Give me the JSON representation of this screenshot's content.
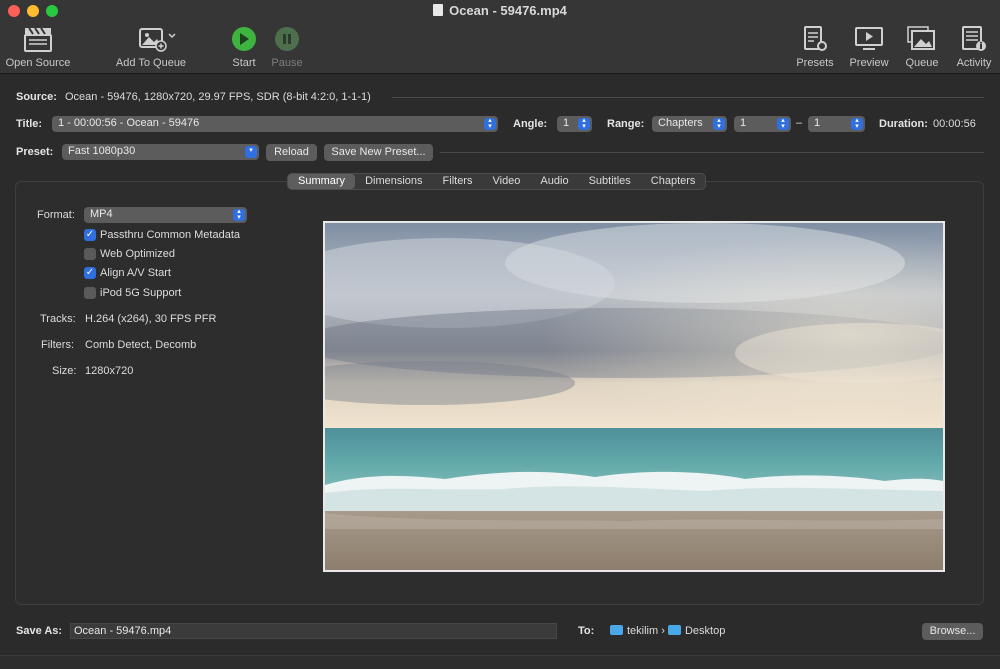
{
  "window": {
    "title": "Ocean - 59476.mp4"
  },
  "toolbar": {
    "open_source": "Open Source",
    "add_to_queue": "Add To Queue",
    "start": "Start",
    "pause": "Pause",
    "presets": "Presets",
    "preview": "Preview",
    "queue": "Queue",
    "activity": "Activity"
  },
  "source": {
    "label": "Source:",
    "value": "Ocean - 59476, 1280x720, 29.97 FPS, SDR (8-bit 4:2:0, 1-1-1)"
  },
  "title_row": {
    "label": "Title:",
    "title_value": "1 - 00:00:56 - Ocean - 59476",
    "angle_label": "Angle:",
    "angle_value": "1",
    "range_label": "Range:",
    "range_type": "Chapters",
    "range_start": "1",
    "range_dash": "–",
    "range_end": "1",
    "duration_label": "Duration:",
    "duration_value": "00:00:56"
  },
  "preset": {
    "label": "Preset:",
    "value": "Fast 1080p30",
    "reload": "Reload",
    "save_new": "Save New Preset..."
  },
  "tabs": [
    "Summary",
    "Dimensions",
    "Filters",
    "Video",
    "Audio",
    "Subtitles",
    "Chapters"
  ],
  "summary": {
    "format_label": "Format:",
    "format_value": "MP4",
    "checkboxes": [
      {
        "label": "Passthru Common Metadata",
        "checked": true
      },
      {
        "label": "Web Optimized",
        "checked": false
      },
      {
        "label": "Align A/V Start",
        "checked": true
      },
      {
        "label": "iPod 5G Support",
        "checked": false
      }
    ],
    "tracks_label": "Tracks:",
    "tracks_value": "H.264 (x264), 30 FPS PFR",
    "filters_label": "Filters:",
    "filters_value": "Comb Detect, Decomb",
    "size_label": "Size:",
    "size_value": "1280x720"
  },
  "save": {
    "label": "Save As:",
    "filename": "Ocean - 59476.mp4",
    "to_label": "To:",
    "path_user": "tekilim",
    "path_sep": "›",
    "path_folder": "Desktop",
    "browse": "Browse..."
  },
  "colors": {
    "accent": "#2f6fe0",
    "start_green": "#3fb33f",
    "folder": "#4aa8e8"
  }
}
